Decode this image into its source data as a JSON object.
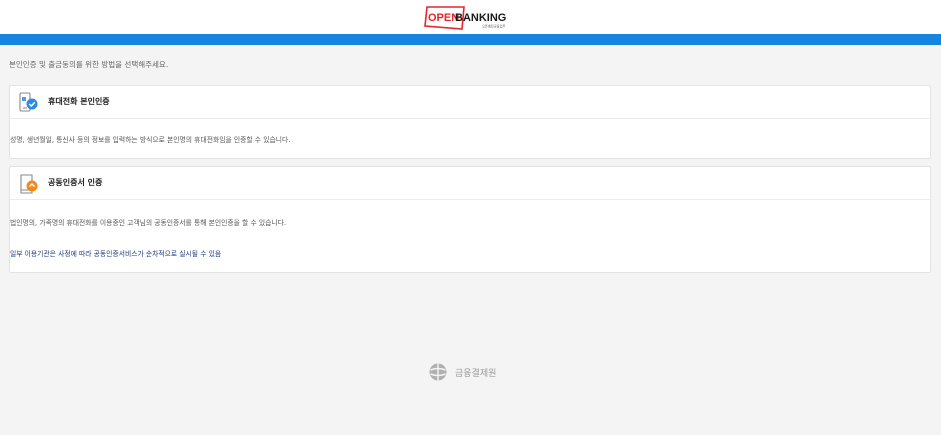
{
  "header": {
    "logo_text_open": "OPEN",
    "logo_text_banking": "BANKING",
    "logo_subtext": "오픈뱅킹공동업무"
  },
  "instruction": "본인인증 및 출금동의를 위한 방법을 선택해주세요.",
  "options": [
    {
      "title": "휴대전화 본인인증",
      "description": "성명, 생년월일, 통신사 등의 정보를 입력하는 방식으로 본인명의 휴대전화임을 인증할 수 있습니다."
    },
    {
      "title": "공동인증서 인증",
      "description": "법인명의, 가족명의 휴대전화를 이용중인 고객님의 공동인증서를 통해 본인인증을 할 수 있습니다.",
      "note": "일부 이용기관은 사정에 따라 공동인증서비스가 순차적으로 실시될 수 있음"
    }
  ],
  "footer": {
    "org_name": "금융결제원"
  },
  "colors": {
    "brand_blue": "#1585e0",
    "brand_red": "#e5262a"
  }
}
